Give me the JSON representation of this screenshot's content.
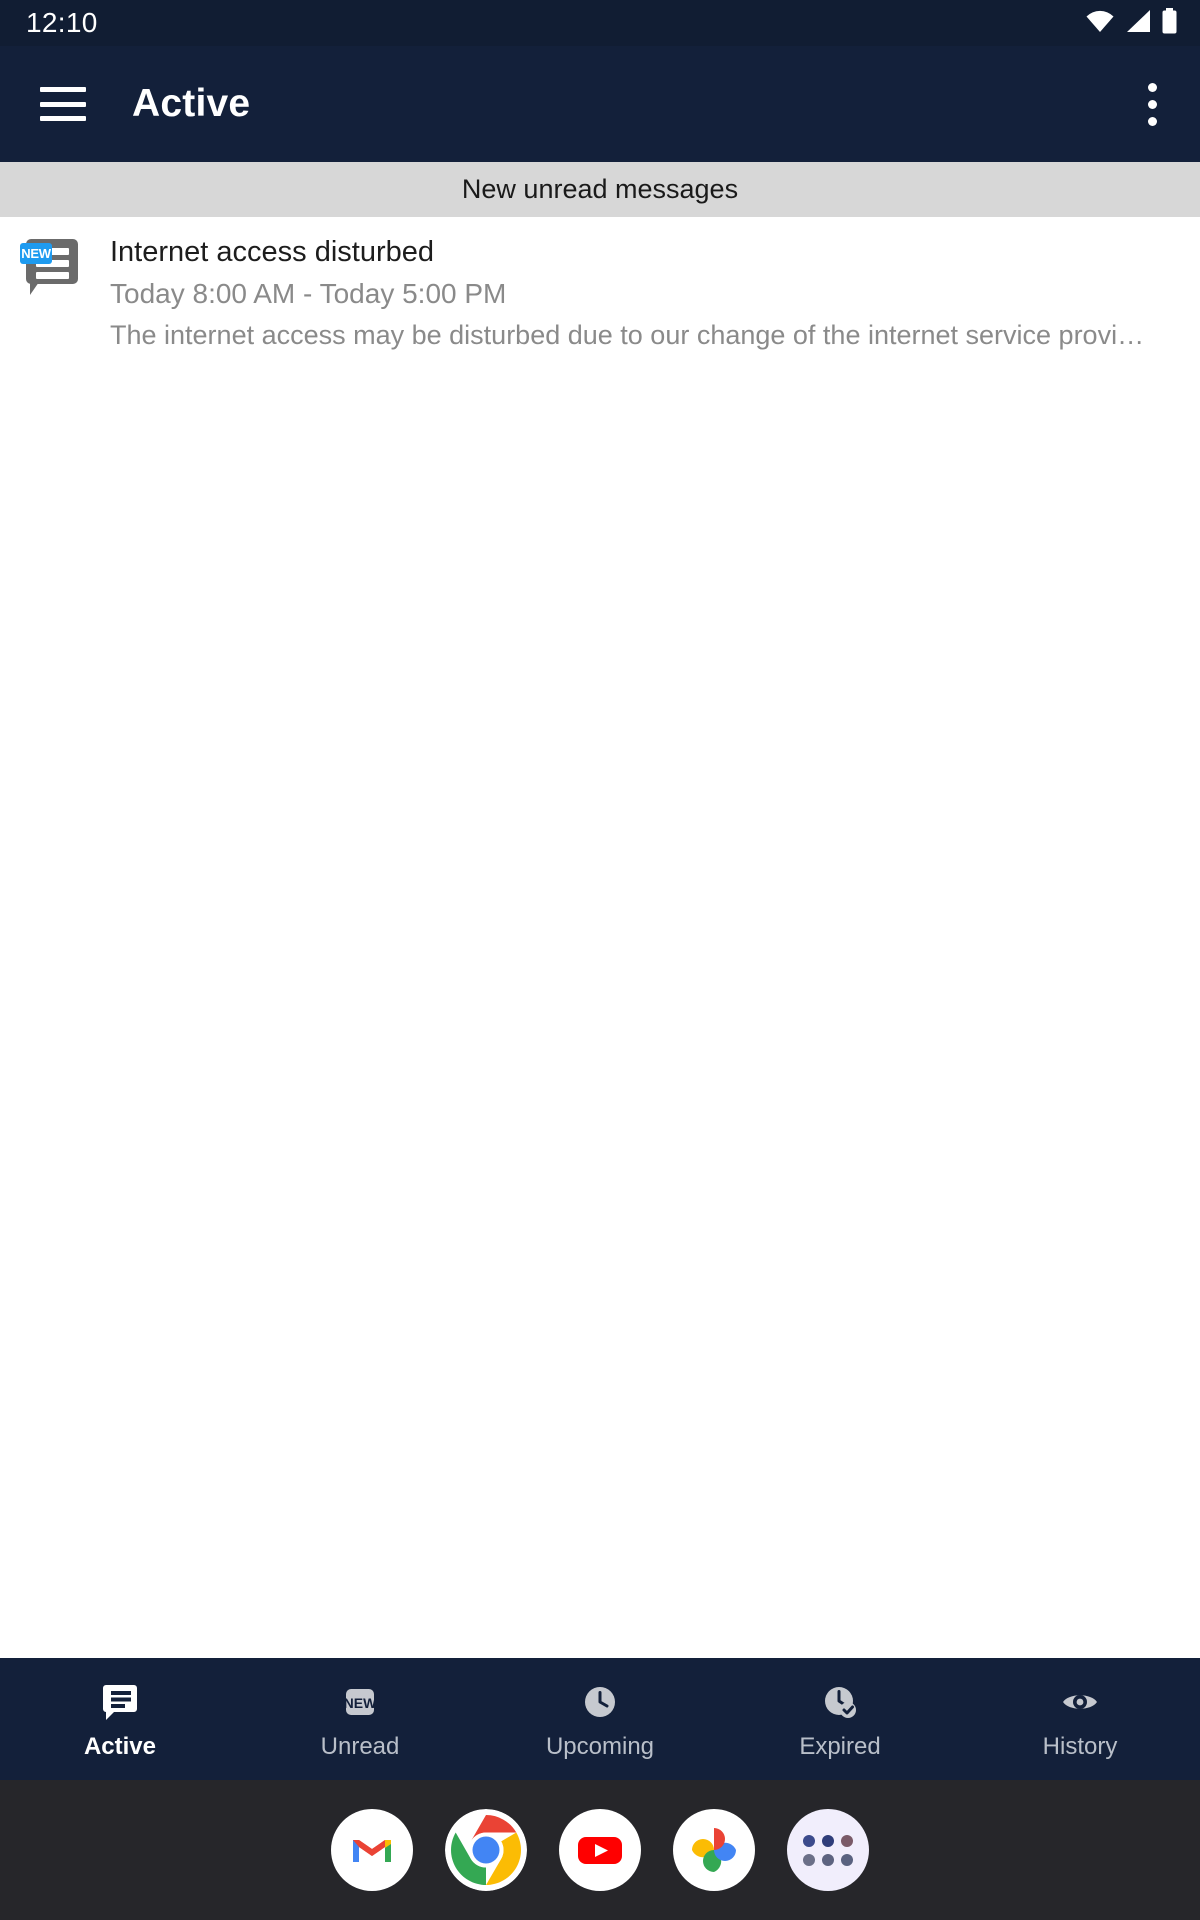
{
  "status_bar": {
    "time": "12:10",
    "icons": [
      "wifi-icon",
      "signal-icon",
      "battery-icon"
    ]
  },
  "app_bar": {
    "menu_icon": "hamburger-menu-icon",
    "title": "Active",
    "overflow_icon": "more-vertical-icon"
  },
  "section_header": {
    "label": "New unread messages"
  },
  "messages": [
    {
      "icon": "message-bubble-icon",
      "badge": "NEW",
      "title": "Internet access disturbed",
      "time_range": "Today 8:00 AM - Today 5:00 PM",
      "preview": "The internet access may be disturbed due to our change of the internet service provi…"
    }
  ],
  "bottom_nav": {
    "items": [
      {
        "label": "Active",
        "icon": "message-bubble-icon",
        "selected": true
      },
      {
        "label": "Unread",
        "icon": "new-badge-icon",
        "selected": false
      },
      {
        "label": "Upcoming",
        "icon": "clock-icon",
        "selected": false
      },
      {
        "label": "Expired",
        "icon": "clock-check-icon",
        "selected": false
      },
      {
        "label": "History",
        "icon": "eye-icon",
        "selected": false
      }
    ]
  },
  "dock": {
    "apps": [
      {
        "name": "gmail-icon"
      },
      {
        "name": "chrome-icon"
      },
      {
        "name": "youtube-icon"
      },
      {
        "name": "google-photos-icon"
      },
      {
        "name": "app-drawer-icon"
      }
    ]
  },
  "colors": {
    "app_bar": "#13203a",
    "status_bar": "#111d33",
    "section_header": "#d7d7d7",
    "badge_blue": "#1e9bf0",
    "secondary_text": "#8a8a8a",
    "dock_background": "#26262a"
  }
}
